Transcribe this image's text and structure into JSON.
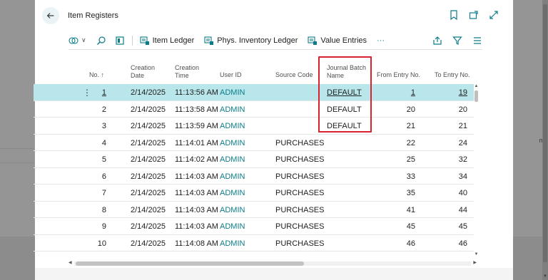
{
  "dialog": {
    "title": "Item Registers"
  },
  "toolbar": {
    "items": [
      {
        "label": "Item Ledger",
        "icon": "ledger-icon"
      },
      {
        "label": "Phys. Inventory Ledger",
        "icon": "ledger-icon"
      },
      {
        "label": "Value Entries",
        "icon": "ledger-icon"
      }
    ],
    "more": "···"
  },
  "table": {
    "headers": {
      "no": "No. ↑",
      "creation_date_1": "Creation",
      "creation_date_2": "Date",
      "creation_time_1": "Creation",
      "creation_time_2": "Time",
      "user_id": "User ID",
      "source_code": "Source Code",
      "journal_batch_1": "Journal Batch",
      "journal_batch_2": "Name",
      "from_entry": "From Entry No.",
      "to_entry": "To Entry No."
    },
    "rows": [
      {
        "no": "1",
        "date": "2/14/2025",
        "time": "11:13:56 AM",
        "user": "ADMIN",
        "source": "",
        "batch": "DEFAULT",
        "from": "1",
        "to": "19"
      },
      {
        "no": "2",
        "date": "2/14/2025",
        "time": "11:13:58 AM",
        "user": "ADMIN",
        "source": "",
        "batch": "DEFAULT",
        "from": "20",
        "to": "20"
      },
      {
        "no": "3",
        "date": "2/14/2025",
        "time": "11:13:59 AM",
        "user": "ADMIN",
        "source": "",
        "batch": "DEFAULT",
        "from": "21",
        "to": "21"
      },
      {
        "no": "4",
        "date": "2/14/2025",
        "time": "11:14:01 AM",
        "user": "ADMIN",
        "source": "PURCHASES",
        "batch": "",
        "from": "22",
        "to": "24"
      },
      {
        "no": "5",
        "date": "2/14/2025",
        "time": "11:14:02 AM",
        "user": "ADMIN",
        "source": "PURCHASES",
        "batch": "",
        "from": "25",
        "to": "32"
      },
      {
        "no": "6",
        "date": "2/14/2025",
        "time": "11:14:03 AM",
        "user": "ADMIN",
        "source": "PURCHASES",
        "batch": "",
        "from": "33",
        "to": "34"
      },
      {
        "no": "7",
        "date": "2/14/2025",
        "time": "11:14:03 AM",
        "user": "ADMIN",
        "source": "PURCHASES",
        "batch": "",
        "from": "35",
        "to": "40"
      },
      {
        "no": "8",
        "date": "2/14/2025",
        "time": "11:14:03 AM",
        "user": "ADMIN",
        "source": "PURCHASES",
        "batch": "",
        "from": "41",
        "to": "44"
      },
      {
        "no": "9",
        "date": "2/14/2025",
        "time": "11:14:03 AM",
        "user": "ADMIN",
        "source": "PURCHASES",
        "batch": "",
        "from": "45",
        "to": "45"
      },
      {
        "no": "10",
        "date": "2/14/2025",
        "time": "11:14:08 AM",
        "user": "ADMIN",
        "source": "PURCHASES",
        "batch": "",
        "from": "46",
        "to": "46"
      }
    ],
    "row_dots": "⋮"
  },
  "background": {
    "cut_text": "mo"
  },
  "colors": {
    "accent": "#0c7c88",
    "selected_row": "#b8e6eb",
    "highlight": "#d9212f"
  }
}
